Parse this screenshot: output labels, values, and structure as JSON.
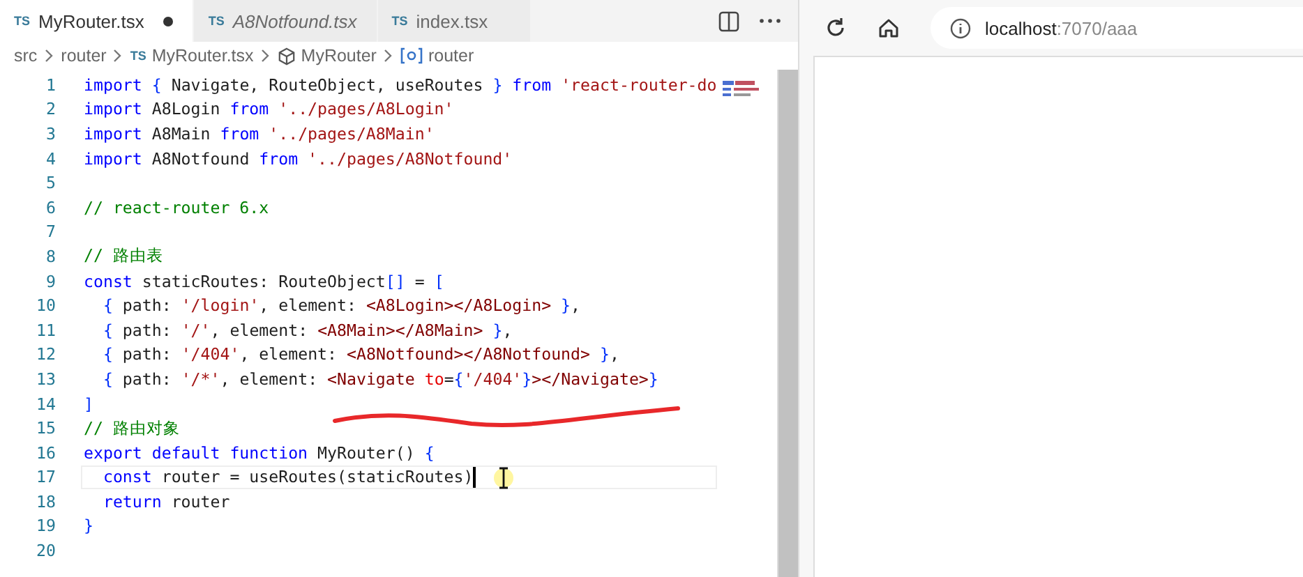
{
  "editor": {
    "tabs": [
      {
        "badge": "TS",
        "label": "MyRouter.tsx",
        "selected": true,
        "modified": true,
        "preview": false
      },
      {
        "badge": "TS",
        "label": "A8Notfound.tsx",
        "selected": false,
        "modified": false,
        "preview": true
      },
      {
        "badge": "TS",
        "label": "index.tsx",
        "selected": false,
        "modified": false,
        "preview": false
      }
    ],
    "breadcrumbs": [
      {
        "kind": "folder",
        "label": "src"
      },
      {
        "kind": "folder",
        "label": "router"
      },
      {
        "kind": "file",
        "badge": "TS",
        "label": "MyRouter.tsx"
      },
      {
        "kind": "class",
        "label": "MyRouter"
      },
      {
        "kind": "variable",
        "label": "router"
      }
    ],
    "lines": [
      {
        "number": "1",
        "current": false,
        "tokens": [
          {
            "kind": "keyword",
            "text": "import"
          },
          {
            "kind": "bracket",
            "text": " { "
          },
          {
            "kind": "plain",
            "text": "Navigate, RouteObject, useRoutes "
          },
          {
            "kind": "bracket",
            "text": "}"
          },
          {
            "kind": "keyword",
            "text": " from "
          },
          {
            "kind": "string",
            "text": "'react-router-do"
          }
        ]
      },
      {
        "number": "2",
        "current": false,
        "tokens": [
          {
            "kind": "keyword",
            "text": "import"
          },
          {
            "kind": "plain",
            "text": " A8Login "
          },
          {
            "kind": "keyword",
            "text": "from"
          },
          {
            "kind": "string",
            "text": " '../pages/A8Login'"
          }
        ]
      },
      {
        "number": "3",
        "current": false,
        "tokens": [
          {
            "kind": "keyword",
            "text": "import"
          },
          {
            "kind": "plain",
            "text": " A8Main "
          },
          {
            "kind": "keyword",
            "text": "from"
          },
          {
            "kind": "string",
            "text": " '../pages/A8Main'"
          }
        ]
      },
      {
        "number": "4",
        "current": false,
        "tokens": [
          {
            "kind": "keyword",
            "text": "import"
          },
          {
            "kind": "plain",
            "text": " A8Notfound "
          },
          {
            "kind": "keyword",
            "text": "from"
          },
          {
            "kind": "string",
            "text": " '../pages/A8Notfound'"
          }
        ]
      },
      {
        "number": "5",
        "current": false
      },
      {
        "number": "6",
        "current": false,
        "tokens": [
          {
            "kind": "comment",
            "text": "// react-router 6.x"
          }
        ]
      },
      {
        "number": "7",
        "current": false
      },
      {
        "number": "8",
        "current": false,
        "tokens": [
          {
            "kind": "comment",
            "text": "// 路由表"
          }
        ]
      },
      {
        "number": "9",
        "current": false,
        "tokens": [
          {
            "kind": "keyword",
            "text": "const"
          },
          {
            "kind": "plain",
            "text": " staticRoutes: RouteObject"
          },
          {
            "kind": "bracket",
            "text": "[]"
          },
          {
            "kind": "plain",
            "text": " = "
          },
          {
            "kind": "bracket",
            "text": "["
          }
        ]
      },
      {
        "number": "10",
        "current": false,
        "tokens": [
          {
            "kind": "bracket",
            "text": "  {"
          },
          {
            "kind": "plain",
            "text": " path: "
          },
          {
            "kind": "string",
            "text": "'/login'"
          },
          {
            "kind": "plain",
            "text": ", element: "
          },
          {
            "kind": "tag",
            "text": "<A8Login></A8Login>"
          },
          {
            "kind": "bracket",
            "text": " }"
          },
          {
            "kind": "plain",
            "text": ","
          }
        ]
      },
      {
        "number": "11",
        "current": false,
        "tokens": [
          {
            "kind": "bracket",
            "text": "  {"
          },
          {
            "kind": "plain",
            "text": " path: "
          },
          {
            "kind": "string",
            "text": "'/'"
          },
          {
            "kind": "plain",
            "text": ", element: "
          },
          {
            "kind": "tag",
            "text": "<A8Main></A8Main>"
          },
          {
            "kind": "bracket",
            "text": " }"
          },
          {
            "kind": "plain",
            "text": ","
          }
        ]
      },
      {
        "number": "12",
        "current": false,
        "tokens": [
          {
            "kind": "bracket",
            "text": "  {"
          },
          {
            "kind": "plain",
            "text": " path: "
          },
          {
            "kind": "string",
            "text": "'/404'"
          },
          {
            "kind": "plain",
            "text": ", element: "
          },
          {
            "kind": "tag",
            "text": "<A8Notfound></A8Notfound>"
          },
          {
            "kind": "bracket",
            "text": " }"
          },
          {
            "kind": "plain",
            "text": ","
          }
        ]
      },
      {
        "number": "13",
        "current": false,
        "tokens": [
          {
            "kind": "bracket",
            "text": "  {"
          },
          {
            "kind": "plain",
            "text": " path: "
          },
          {
            "kind": "string",
            "text": "'/*'"
          },
          {
            "kind": "plain",
            "text": ", element: "
          },
          {
            "kind": "tag",
            "text": "<Navigate "
          },
          {
            "kind": "variable",
            "text": "to"
          },
          {
            "kind": "plain",
            "text": "="
          },
          {
            "kind": "bracket",
            "text": "{"
          },
          {
            "kind": "string",
            "text": "'/404'"
          },
          {
            "kind": "bracket",
            "text": "}"
          },
          {
            "kind": "tag",
            "text": "></Navigate>"
          },
          {
            "kind": "bracket",
            "text": "}"
          }
        ]
      },
      {
        "number": "14",
        "current": false,
        "tokens": [
          {
            "kind": "bracket",
            "text": "]"
          }
        ]
      },
      {
        "number": "15",
        "current": false,
        "tokens": [
          {
            "kind": "comment",
            "text": "// 路由对象"
          }
        ]
      },
      {
        "number": "16",
        "current": false,
        "tokens": [
          {
            "kind": "keyword",
            "text": "export default function"
          },
          {
            "kind": "plain",
            "text": " MyRouter() "
          },
          {
            "kind": "bracket",
            "text": "{"
          }
        ]
      },
      {
        "number": "17",
        "current": true,
        "tokens": [
          {
            "kind": "keyword",
            "text": "  const"
          },
          {
            "kind": "plain",
            "text": " router = useRoutes(staticRoutes)"
          }
        ]
      },
      {
        "number": "18",
        "current": false,
        "tokens": [
          {
            "kind": "keyword",
            "text": "  return"
          },
          {
            "kind": "plain",
            "text": " router"
          }
        ]
      },
      {
        "number": "19",
        "current": false,
        "tokens": [
          {
            "kind": "bracket",
            "text": "}"
          }
        ]
      },
      {
        "number": "20",
        "current": false
      }
    ]
  },
  "browser": {
    "url_host": "localhost",
    "url_rest": ":7070/aaa"
  }
}
